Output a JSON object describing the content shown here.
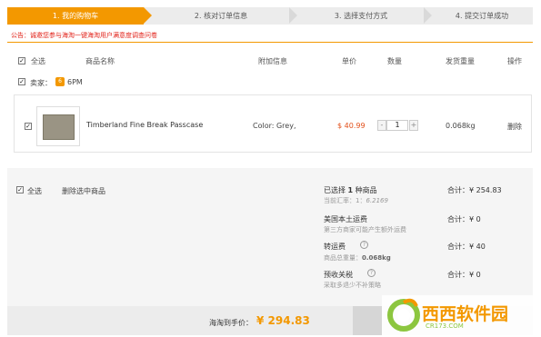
{
  "steps": [
    {
      "label": "1. 我的购物车",
      "active": true
    },
    {
      "label": "2. 核对订单信息",
      "active": false
    },
    {
      "label": "3. 选择支付方式",
      "active": false
    },
    {
      "label": "4. 提交订单成功",
      "active": false
    }
  ],
  "notice": "公告：诚邀您参与海淘一键海淘用户满意度调查问卷",
  "table_header": {
    "select_all": "全选",
    "product_name": "商品名称",
    "extra_info": "附加信息",
    "unit_price": "单价",
    "quantity": "数量",
    "weight": "发货重量",
    "action": "操作"
  },
  "seller": {
    "label": "卖家：",
    "icon": "6pm-store-icon",
    "name": "6PM"
  },
  "item": {
    "name": "Timberland Fine Break Passcase",
    "extra": "Color: Grey,",
    "price": "$ 40.99",
    "qty": "1",
    "minus": "-",
    "plus": "+",
    "weight": "0.068kg",
    "delete": "删除"
  },
  "summary": {
    "select_all": "全选",
    "delete_selected": "删除选中商品",
    "selected_prefix": "已选择",
    "selected_count": "1",
    "selected_suffix": "种商品",
    "rate_label": "当前汇率：1：",
    "rate_value": "6.2169",
    "subtotal": "合计：¥ 254.83",
    "us_shipping": "美国本土运费",
    "us_shipping_note": "第三方商家可能产生额外运费",
    "us_shipping_total": "合计：¥ 0",
    "transfer_fee": "转运费",
    "transfer_weight_label": "商品总重量：",
    "transfer_weight": "0.068kg",
    "transfer_total": "合计：¥ 40",
    "tax": "预收关税",
    "tax_note": "采取多退少不补策略",
    "tax_total": "合计：¥ 0"
  },
  "total": {
    "label": "海淘到手价：",
    "value": "¥ 294.83"
  },
  "watermark": {
    "cn": "西西软件园",
    "url": "CR173.COM"
  },
  "colors": {
    "accent": "#f39800",
    "price": "#e2501a",
    "notice": "#e2231a"
  }
}
